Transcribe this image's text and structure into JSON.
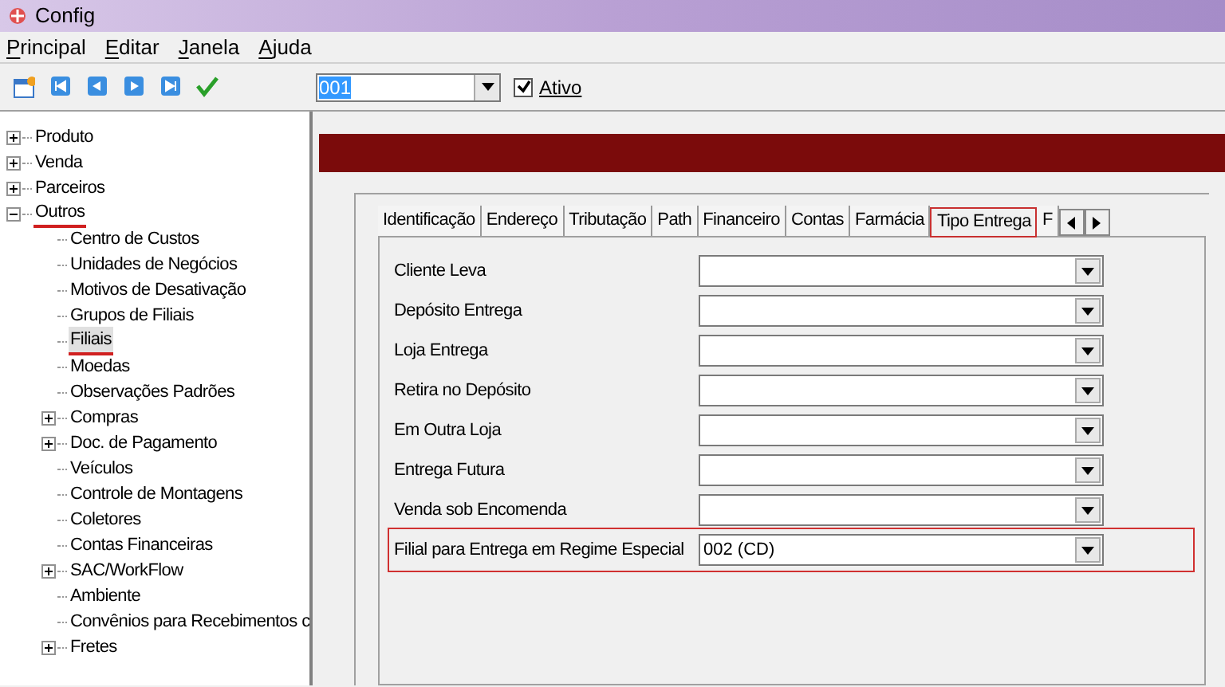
{
  "window": {
    "title": "Config"
  },
  "menu": [
    {
      "label": "Principal"
    },
    {
      "label": "Editar"
    },
    {
      "label": "Janela"
    },
    {
      "label": "Ajuda"
    }
  ],
  "toolbar": {
    "buttons": [
      {
        "kind": "new"
      },
      {
        "kind": "first"
      },
      {
        "kind": "prev"
      },
      {
        "kind": "next"
      },
      {
        "kind": "last"
      },
      {
        "kind": "confirm"
      }
    ],
    "code": {
      "value": "001"
    },
    "ativo": {
      "label": "Ativo",
      "checked": true
    }
  },
  "tree": [
    {
      "label": "Produto",
      "expanded": false
    },
    {
      "label": "Venda",
      "expanded": false
    },
    {
      "label": "Parceiros",
      "expanded": false
    },
    {
      "label": "Outros",
      "expanded": true,
      "annotated": true,
      "children": [
        {
          "label": "Centro de Custos"
        },
        {
          "label": "Unidades de Negócios"
        },
        {
          "label": "Motivos de Desativação"
        },
        {
          "label": "Grupos de Filiais"
        },
        {
          "label": "Filiais",
          "selected": true,
          "annotated": true
        },
        {
          "label": "Moedas"
        },
        {
          "label": "Observações Padrões"
        },
        {
          "label": "Compras",
          "expanded": false
        },
        {
          "label": "Doc. de Pagamento",
          "expanded": false
        },
        {
          "label": "Veículos"
        },
        {
          "label": "Controle de Montagens"
        },
        {
          "label": "Coletores"
        },
        {
          "label": "Contas Financeiras"
        },
        {
          "label": "SAC/WorkFlow",
          "expanded": false
        },
        {
          "label": "Ambiente"
        },
        {
          "label": "Convênios para Recebimentos c"
        },
        {
          "label": "Fretes",
          "expanded": false
        }
      ]
    }
  ],
  "tabs": [
    {
      "label": "Identificação",
      "selected": false
    },
    {
      "label": "Endereço",
      "selected": false
    },
    {
      "label": "Tributação",
      "selected": false
    },
    {
      "label": "Path",
      "selected": false
    },
    {
      "label": "Financeiro",
      "selected": false
    },
    {
      "label": "Contas",
      "selected": false
    },
    {
      "label": "Farmácia",
      "selected": false
    },
    {
      "label": "Tipo Entrega",
      "selected": true
    },
    {
      "label": "F",
      "selected": false
    }
  ],
  "fields": [
    {
      "label": "Cliente Leva",
      "highlighted": false
    },
    {
      "label": "Depósito Entrega",
      "highlighted": false
    },
    {
      "label": "Loja Entrega",
      "highlighted": false
    },
    {
      "label": "Retira no Depósito",
      "highlighted": false
    },
    {
      "label": "Em Outra Loja",
      "highlighted": false
    },
    {
      "label": "Entrega Futura",
      "highlighted": false
    },
    {
      "label": "Venda sob Encomenda",
      "highlighted": false
    },
    {
      "label": "Filial para Entrega em Regime Especial",
      "value": "002 (CD)",
      "highlighted": true
    }
  ]
}
